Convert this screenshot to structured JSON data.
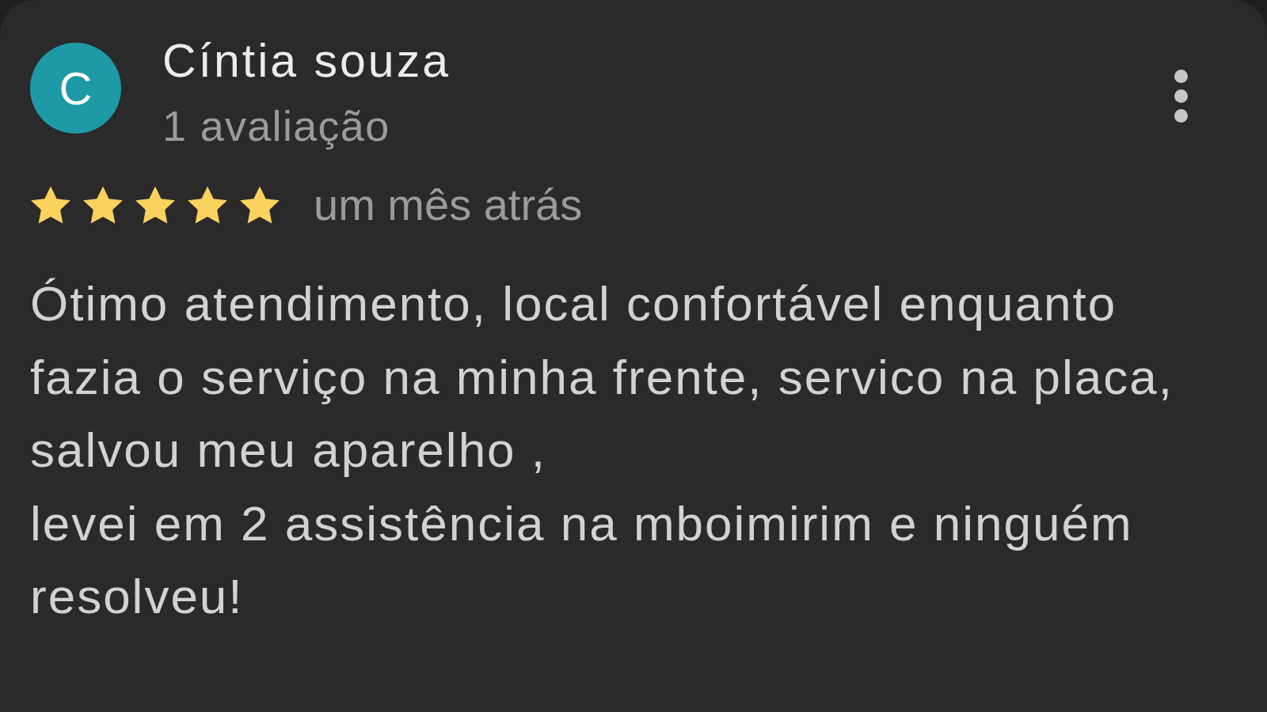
{
  "review": {
    "author": {
      "initial": "C",
      "name": "Cíntia souza",
      "review_count": "1 avaliação"
    },
    "stars": 5,
    "date": "um mês atrás",
    "text": "Ótimo atendimento, local confortável enquanto fazia o serviço na minha frente, servico na placa, salvou meu aparelho ,\nlevei em 2 assistência na mboimirim e ninguém resolveu!"
  }
}
